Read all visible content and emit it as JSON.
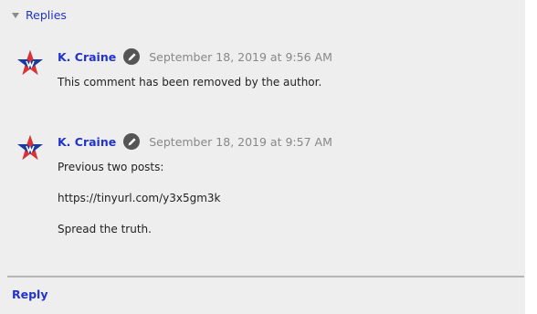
{
  "thread": {
    "toggle_label": "Replies",
    "reply_label": "Reply"
  },
  "comments": [
    {
      "author": "K. Craine",
      "timestamp": "September 18, 2019 at 9:56 AM",
      "lines": [
        "This comment has been removed by the author."
      ]
    },
    {
      "author": "K. Craine",
      "timestamp": "September 18, 2019 at 9:57 AM",
      "lines": [
        "Previous two posts:",
        "https://tinyurl.com/y3x5gm3k",
        "Spread the truth."
      ]
    }
  ],
  "icons": {
    "toggle": "triangle-down-icon",
    "badge": "pencil-icon",
    "avatar": "star-avatar"
  },
  "colors": {
    "link": "#2233cc",
    "meta": "#888888",
    "background": "#eeeeee"
  }
}
